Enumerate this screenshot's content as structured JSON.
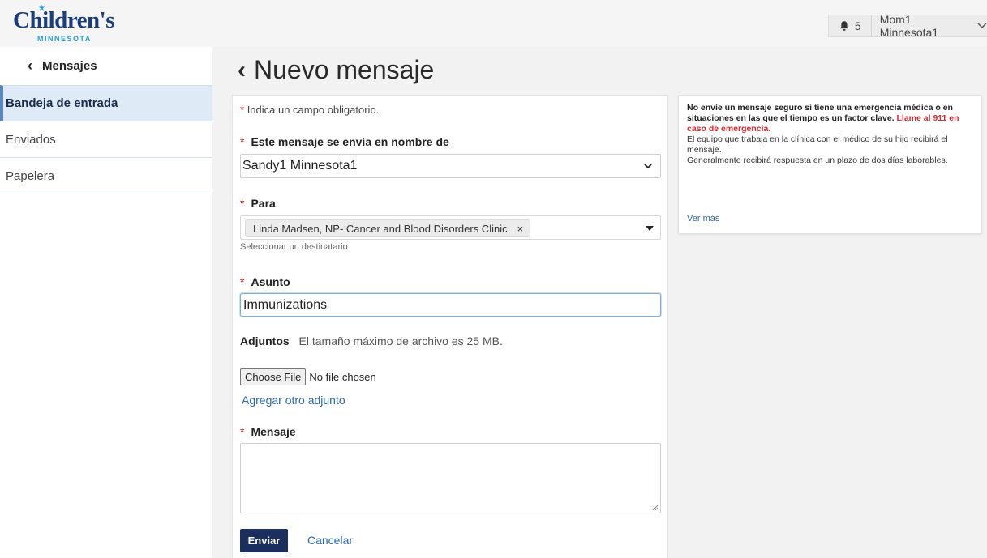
{
  "brand": {
    "logo_name": "Children's",
    "logo_sub": "MINNESOTA",
    "colors": {
      "navy": "#1a3d7c",
      "sky": "#29a0d8",
      "send_button": "#1a2f5e",
      "link": "#2a6aad",
      "required": "#e0262b"
    }
  },
  "header": {
    "notification_icon": "bell-icon",
    "notification_count": "5",
    "user_name": "Mom1 Minnesota1",
    "user_menu_icon": "chevron-down-icon"
  },
  "sidebar": {
    "back_label": "Mensajes",
    "items": [
      {
        "label": "Bandeja de entrada",
        "active": true
      },
      {
        "label": "Enviados",
        "active": false
      },
      {
        "label": "Papelera",
        "active": false
      }
    ]
  },
  "page": {
    "title": "Nuevo mensaje"
  },
  "form": {
    "required_marker": "*",
    "required_note": "Indica un campo obligatorio.",
    "on_behalf_label": "Este mensaje se envía en nombre de",
    "on_behalf_value": "Sandy1 Minnesota1",
    "to_label": "Para",
    "recipient_chip": "Linda Madsen, NP- Cancer and Blood Disorders Clinic",
    "remove_chip": "×",
    "to_help": "Seleccionar un destinatario",
    "subject_label": "Asunto",
    "subject_value": "Immunizations",
    "attachments_label": "Adjuntos",
    "attachments_max": "El tamaño máximo de archivo es 25 MB.",
    "choose_file": "Choose File",
    "no_file": "No file chosen",
    "add_attachment": "Agregar otro adjunto",
    "message_label": "Mensaje",
    "message_value": "",
    "send": "Enviar",
    "cancel": "Cancelar"
  },
  "info": {
    "warning": "No envíe un mensaje seguro si tiene una emergencia médica o en situaciones en las que el tiempo es un factor clave.",
    "emergency": "Llame al 911 en caso de emergencia.",
    "line1": "El equipo que trabaja en la clínica con el médico de su hijo recibirá el mensaje.",
    "line2": "Generalmente recibirá respuesta en un plazo de dos días laborables.",
    "more": "Ver más"
  }
}
